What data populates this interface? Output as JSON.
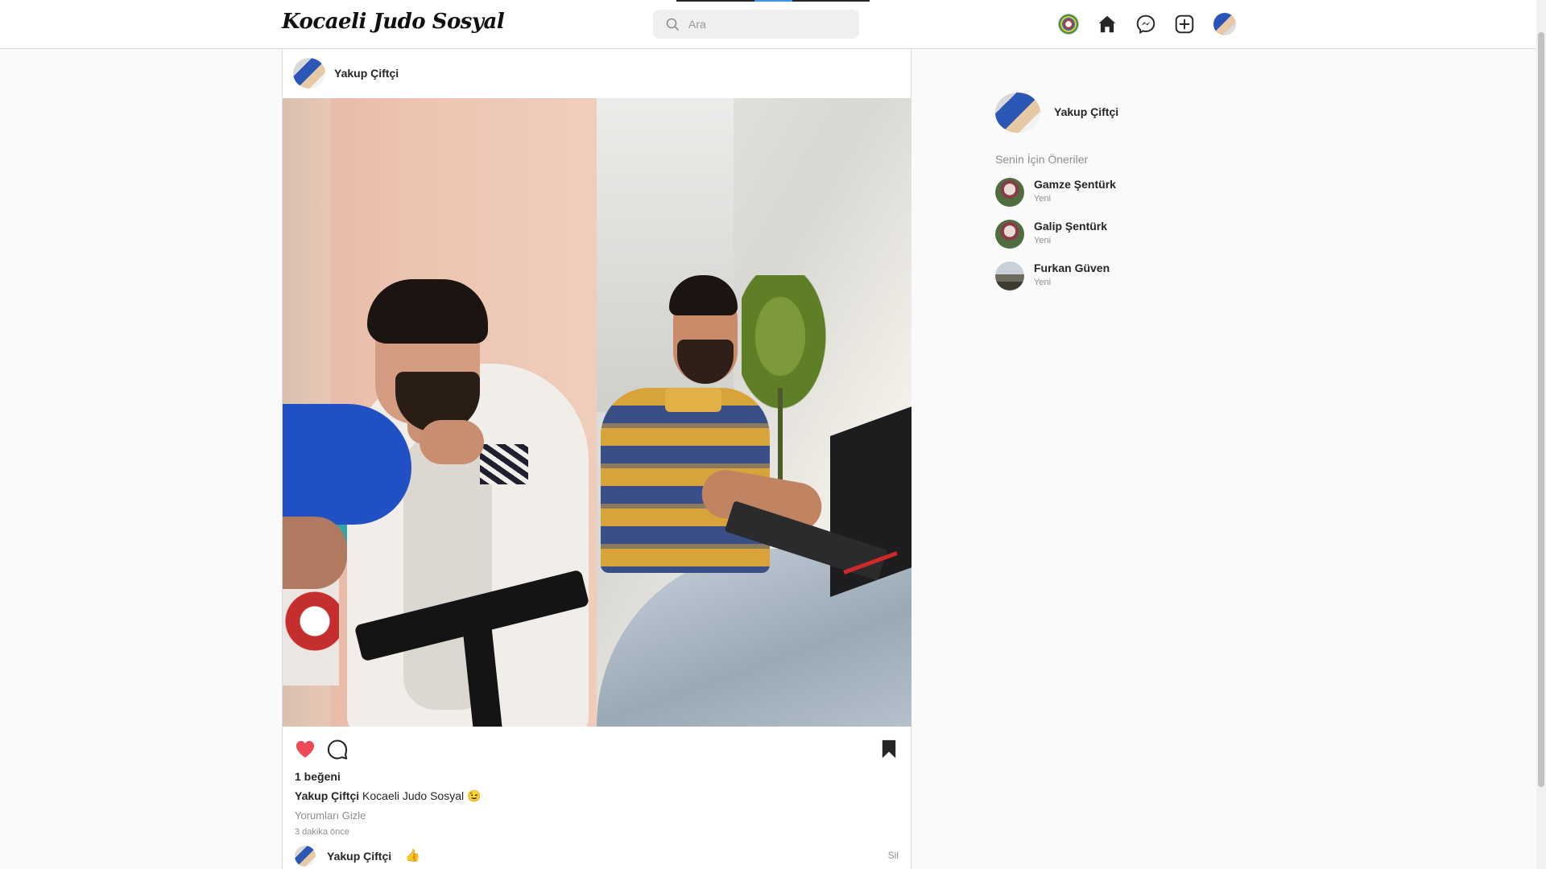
{
  "header": {
    "logo": "Kocaeli Judo Sosyal",
    "search_placeholder": "Ara",
    "nav_icons": [
      "emblem-icon",
      "home-icon",
      "messenger-icon",
      "add-post-icon",
      "profile-avatar"
    ]
  },
  "post": {
    "username": "Yakup Çiftçi",
    "liked": true,
    "likes": "1 beğeni",
    "caption_user": "Yakup Çiftçi",
    "caption_text": "Kocaeli Judo Sosyal",
    "caption_emoji": "😉",
    "hide_comments": "Yorumları Gizle",
    "time": "3 dakika önce",
    "comment": {
      "user": "Yakup Çiftçi",
      "text": "👍",
      "delete": "Sil"
    }
  },
  "sidebar": {
    "profile_name": "Yakup Çiftçi",
    "heading": "Senin İçin Öneriler",
    "suggestions": [
      {
        "name": "Gamze Şentürk",
        "sub": "Yeni"
      },
      {
        "name": "Galip Şentürk",
        "sub": "Yeni"
      },
      {
        "name": "Furkan Güven",
        "sub": "Yeni"
      }
    ]
  },
  "colors": {
    "like_red": "#ed4956",
    "border": "#dbdbdb",
    "muted": "#8e8e8e"
  }
}
